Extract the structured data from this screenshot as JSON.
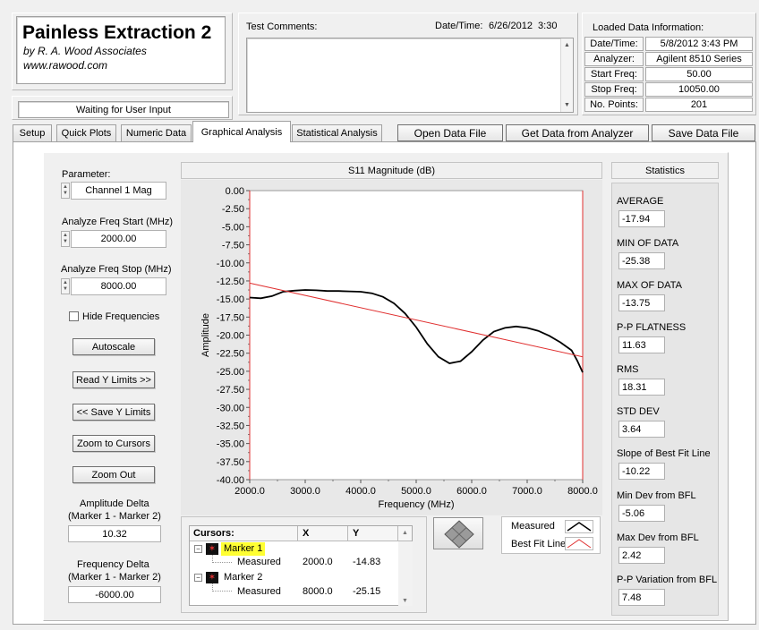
{
  "app": {
    "title": "Painless Extraction 2",
    "author": "by R. A. Wood Associates",
    "website": "www.rawood.com",
    "status": "Waiting for User Input"
  },
  "header": {
    "test_comments_label": "Test Comments:",
    "datetime_label": "Date/Time:",
    "datetime_value": "6/26/2012  3:30",
    "loaded_info_title": "Loaded Data Information:",
    "loaded_info": [
      {
        "key": "Date/Time:",
        "value": "5/8/2012 3:43 PM"
      },
      {
        "key": "Analyzer:",
        "value": "Agilent 8510 Series"
      },
      {
        "key": "Start Freq:",
        "value": "50.00"
      },
      {
        "key": "Stop Freq:",
        "value": "10050.00"
      },
      {
        "key": "No. Points:",
        "value": "201"
      }
    ]
  },
  "tabs": [
    "Setup",
    "Quick Plots",
    "Numeric Data",
    "Graphical Analysis",
    "Statistical Analysis"
  ],
  "active_tab": "Graphical Analysis",
  "actions": {
    "open": "Open Data File",
    "get": "Get Data from Analyzer",
    "save": "Save Data File"
  },
  "left_panel": {
    "parameter_label": "Parameter:",
    "parameter_value": "Channel 1 Mag",
    "start_label": "Analyze Freq Start (MHz)",
    "start_value": "2000.00",
    "stop_label": "Analyze Freq Stop (MHz)",
    "stop_value": "8000.00",
    "hide_freq_label": "Hide Frequencies",
    "hide_freq_checked": false,
    "autoscale": "Autoscale",
    "read_y": "Read Y Limits >>",
    "save_y": "<< Save Y Limits",
    "zoom_cursors": "Zoom to Cursors",
    "zoom_out": "Zoom Out",
    "amp_delta_label1": "Amplitude Delta",
    "amp_delta_label2": "(Marker 1 - Marker 2)",
    "amp_delta_value": "10.32",
    "freq_delta_label1": "Frequency Delta",
    "freq_delta_label2": "(Marker 1 - Marker 2)",
    "freq_delta_value": "-6000.00"
  },
  "chart_data": {
    "type": "line",
    "title": "S11 Magnitude (dB)",
    "xlabel": "Frequency (MHz)",
    "ylabel": "Amplitude",
    "xlim": [
      2000,
      8000
    ],
    "ylim": [
      -40,
      0
    ],
    "x_ticks": [
      "2000.0",
      "3000.0",
      "4000.0",
      "5000.0",
      "6000.0",
      "7000.0",
      "8000.0"
    ],
    "y_ticks": [
      "0.00",
      "-2.50",
      "-5.00",
      "-7.50",
      "-10.00",
      "-12.50",
      "-15.00",
      "-17.50",
      "-20.00",
      "-22.50",
      "-25.00",
      "-27.50",
      "-30.00",
      "-32.50",
      "-35.00",
      "-37.50",
      "-40.00"
    ],
    "grid": false,
    "series": [
      {
        "name": "Measured",
        "color": "#000000",
        "x": [
          2000,
          2200,
          2400,
          2600,
          2800,
          3000,
          3200,
          3400,
          3600,
          3800,
          4000,
          4200,
          4400,
          4600,
          4800,
          5000,
          5200,
          5400,
          5600,
          5800,
          6000,
          6200,
          6400,
          6600,
          6800,
          7000,
          7200,
          7400,
          7600,
          7800,
          7900,
          8000
        ],
        "y": [
          -14.8,
          -14.9,
          -14.6,
          -14.0,
          -13.85,
          -13.75,
          -13.8,
          -13.9,
          -13.9,
          -13.95,
          -14.0,
          -14.2,
          -14.7,
          -15.6,
          -17.0,
          -18.9,
          -21.2,
          -23.0,
          -23.9,
          -23.6,
          -22.3,
          -20.7,
          -19.5,
          -19.0,
          -18.8,
          -19.0,
          -19.4,
          -20.1,
          -21.0,
          -22.1,
          -23.5,
          -25.15
        ]
      },
      {
        "name": "Best Fit Line",
        "color": "#e03030",
        "x": [
          2000,
          8000
        ],
        "y": [
          -12.8,
          -23.0
        ]
      }
    ],
    "legend": [
      {
        "name": "Measured"
      },
      {
        "name": "Best Fit Line"
      }
    ],
    "legend_position": "bottom-right"
  },
  "cursors": {
    "header": [
      "Cursors:",
      "X",
      "Y"
    ],
    "rows": [
      {
        "name": "Marker 1",
        "sub": "Measured",
        "x": "2000.0",
        "y": "-14.83",
        "highlight": true
      },
      {
        "name": "Marker 2",
        "sub": "Measured",
        "x": "8000.0",
        "y": "-25.15",
        "highlight": false
      }
    ]
  },
  "statistics": {
    "title": "Statistics",
    "items": [
      {
        "label": "AVERAGE",
        "value": "-17.94"
      },
      {
        "label": "MIN OF DATA",
        "value": "-25.38"
      },
      {
        "label": "MAX OF DATA",
        "value": "-13.75"
      },
      {
        "label": "P-P FLATNESS",
        "value": "11.63"
      },
      {
        "label": "RMS",
        "value": "18.31"
      },
      {
        "label": "STD DEV",
        "value": "3.64"
      },
      {
        "label": "Slope of Best Fit Line",
        "value": "-10.22"
      },
      {
        "label": "Min Dev from BFL",
        "value": "-5.06"
      },
      {
        "label": "Max Dev from BFL",
        "value": "2.42"
      },
      {
        "label": "P-P Variation from BFL",
        "value": "7.48"
      }
    ]
  }
}
